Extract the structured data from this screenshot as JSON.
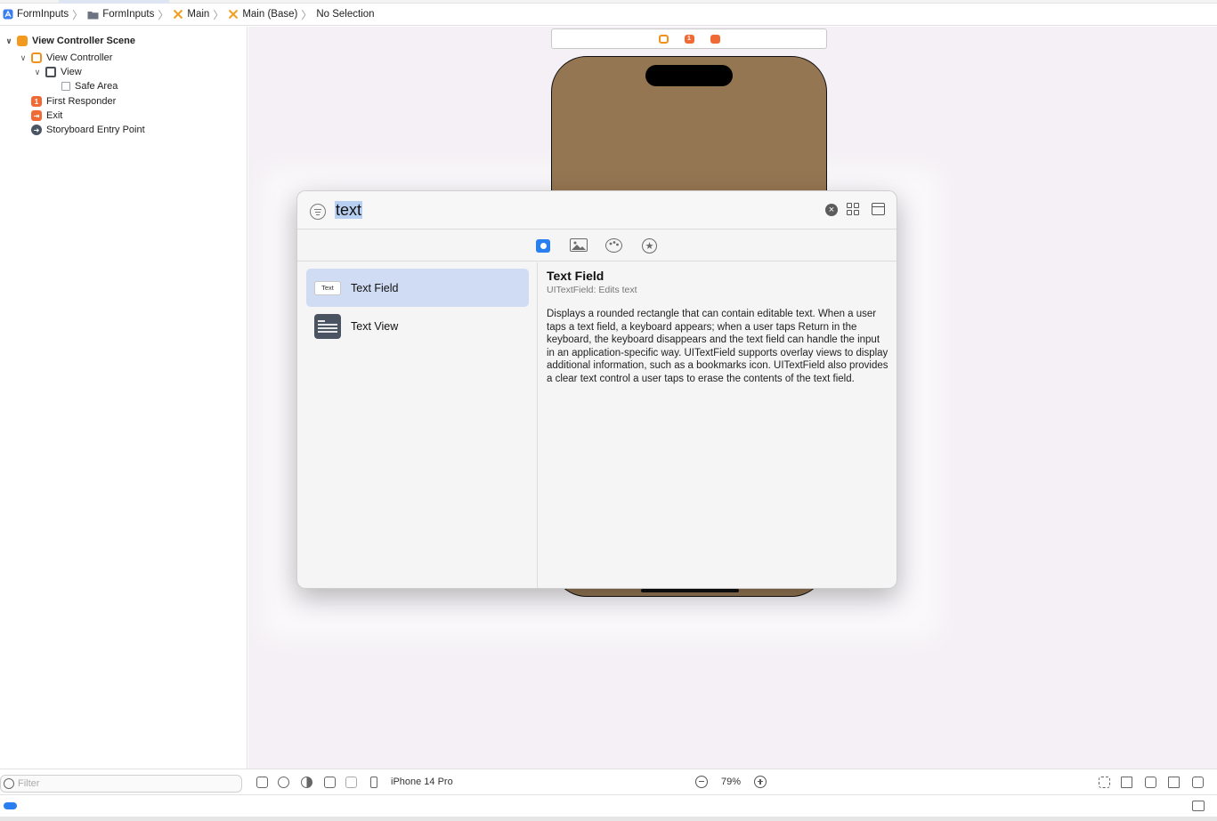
{
  "breadcrumb": [
    {
      "label": "FormInputs",
      "icon": "app-icon"
    },
    {
      "label": "FormInputs",
      "icon": "folder-icon"
    },
    {
      "label": "Main",
      "icon": "storyboard-icon"
    },
    {
      "label": "Main (Base)",
      "icon": "storyboard-icon"
    },
    {
      "label": "No Selection",
      "icon": ""
    }
  ],
  "outline": {
    "scene": "View Controller Scene",
    "view_controller": "View Controller",
    "view": "View",
    "safe_area": "Safe Area",
    "first_responder": "First Responder",
    "exit": "Exit",
    "entry_point": "Storyboard Entry Point"
  },
  "library": {
    "search_value": "text",
    "tabs": [
      "objects",
      "media",
      "colors",
      "snippets"
    ],
    "items": [
      {
        "label": "Text Field",
        "icon_text": "Text",
        "selected": true
      },
      {
        "label": "Text View",
        "selected": false
      }
    ],
    "detail": {
      "title": "Text Field",
      "subtitle": "UITextField: Edits text",
      "description": "Displays a rounded rectangle that can contain editable text. When a user taps a text field, a keyboard appears; when a user taps Return in the keyboard, the keyboard disappears and the text field can handle the input in an application-specific way. UITextField supports overlay views to display additional information, such as a bookmarks icon. UITextField also provides a clear text control a user taps to erase the contents of the text field."
    }
  },
  "canvas": {
    "scene_dock": [
      "view-controller-icon",
      "first-responder-icon",
      "exit-icon"
    ],
    "scene_dock_badge": "1",
    "device_color": "#957653"
  },
  "bottom": {
    "filter_placeholder": "Filter",
    "device": "iPhone 14 Pro",
    "zoom": "79%"
  },
  "colors": {
    "accent": "#2a7ff0",
    "selection": "#cfdcf3",
    "canvas": "#f4f0f5"
  }
}
